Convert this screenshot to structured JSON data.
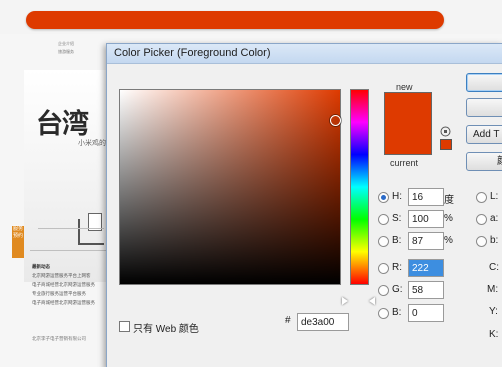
{
  "colors": {
    "selected": "#de3a00",
    "selection_highlight": "#3d8ee0"
  },
  "background_page": {
    "nav": [
      "企业介绍",
      "旅游服务"
    ],
    "hero_title": "台湾",
    "hero_subtitle": "小米鸡的",
    "side_tag": "服务预约",
    "news_heading": "最新动态",
    "news_items": [
      "北京网游运营服务平台上网客",
      "电子商城经营北京网游运营服务",
      "专业旅行服务运营平台服务",
      "电子商城经营北京网游运营服务"
    ],
    "footer": "北京李子电子营销有限公司"
  },
  "dialog": {
    "title": "Color Picker (Foreground Color)",
    "label_new": "new",
    "label_current": "current",
    "buttons": {
      "ok": "",
      "cancel": "",
      "add_to_swatches": "Add T",
      "color_libraries": "颜"
    },
    "hsb": {
      "h": {
        "label": "H:",
        "value": "16",
        "unit": "度"
      },
      "s": {
        "label": "S:",
        "value": "100",
        "unit": "%"
      },
      "b": {
        "label": "B:",
        "value": "87",
        "unit": "%"
      }
    },
    "rgb": {
      "r": {
        "label": "R:",
        "value": "222"
      },
      "g": {
        "label": "G:",
        "value": "58"
      },
      "b": {
        "label": "B:",
        "value": "0"
      }
    },
    "lab": {
      "l": {
        "label": "L:"
      },
      "a": {
        "label": "a:"
      },
      "b": {
        "label": "b:"
      }
    },
    "cmyk": {
      "c": {
        "label": "C:"
      },
      "m": {
        "label": "M:"
      },
      "y": {
        "label": "Y:"
      },
      "k": {
        "label": "K:"
      }
    },
    "hex": {
      "label": "#",
      "value": "de3a00"
    },
    "web_only": "只有 Web 颜色"
  }
}
